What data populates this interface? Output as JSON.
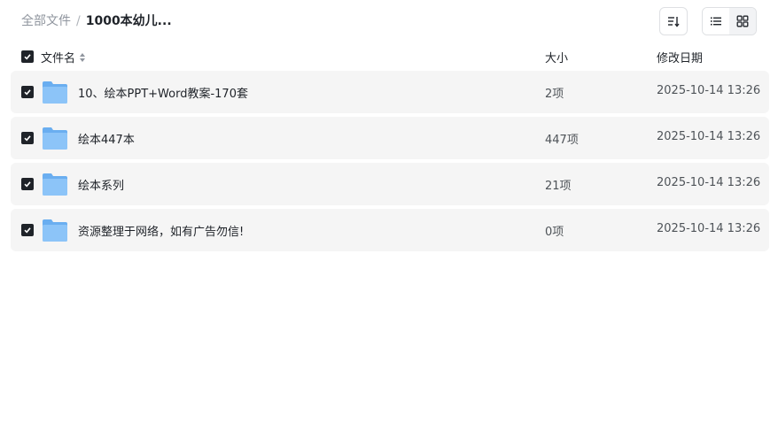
{
  "breadcrumb": {
    "root": "全部文件",
    "separator": "/",
    "current": "1000本幼儿..."
  },
  "toolbar": {
    "sort_icon": "sort-icon",
    "list_view_icon": "list-icon",
    "grid_view_icon": "grid-icon",
    "active_view": "list"
  },
  "table": {
    "columns": {
      "name": "文件名",
      "size": "大小",
      "date": "修改日期"
    },
    "rows": [
      {
        "name": "10、绘本PPT+Word教案-170套",
        "size": "2项",
        "date": "2025-10-14 13:26",
        "checked": true
      },
      {
        "name": "绘本447本",
        "size": "447项",
        "date": "2025-10-14 13:26",
        "checked": true
      },
      {
        "name": "绘本系列",
        "size": "21项",
        "date": "2025-10-14 13:26",
        "checked": true
      },
      {
        "name": "资源整理于网络，如有广告勿信!",
        "size": "0项",
        "date": "2025-10-14 13:26",
        "checked": true
      }
    ]
  },
  "colors": {
    "row_bg": "#f5f5f5",
    "folder_blue": "#7cb8f5",
    "checkbox": "#1f2329"
  }
}
